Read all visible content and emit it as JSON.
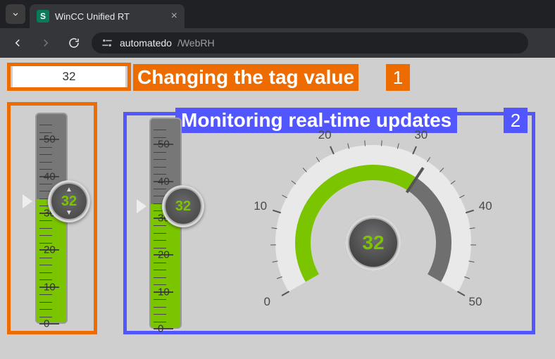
{
  "browser": {
    "tab_title": "WinCC Unified RT",
    "favicon_letter": "S",
    "url_host": "automatedo",
    "url_path": "/WebRH"
  },
  "input": {
    "value": "32"
  },
  "annotations": {
    "orange_label": "Changing the tag value",
    "orange_badge": "1",
    "blue_label": "Monitoring real-time updates",
    "blue_badge": "2"
  },
  "chart_data": [
    {
      "type": "bar",
      "name": "slider-1-editable",
      "range": [
        0,
        55
      ],
      "value": 32,
      "ticks_major": [
        0,
        10,
        20,
        30,
        40,
        50
      ],
      "tick_labels": [
        "0",
        "10",
        "20",
        "30",
        "40",
        "50"
      ]
    },
    {
      "type": "bar",
      "name": "slider-2-readonly",
      "range": [
        0,
        55
      ],
      "value": 32,
      "ticks_major": [
        0,
        10,
        20,
        30,
        40,
        50
      ],
      "tick_labels": [
        "0",
        "10",
        "20",
        "30",
        "40",
        "50"
      ]
    },
    {
      "type": "area",
      "name": "circular-gauge",
      "range": [
        0,
        50
      ],
      "value": 32,
      "ticks_major": [
        0,
        10,
        20,
        30,
        40,
        50
      ],
      "tick_labels": [
        "0",
        "10",
        "20",
        "30",
        "40",
        "50"
      ]
    }
  ]
}
